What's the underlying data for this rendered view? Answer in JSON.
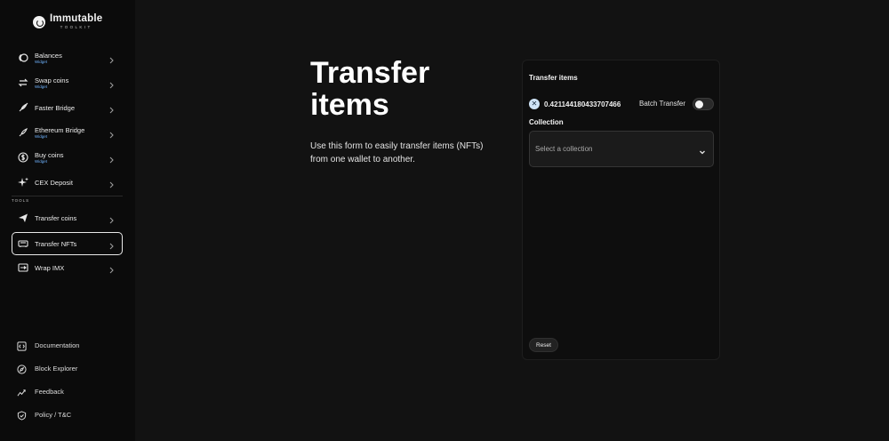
{
  "app": {
    "name": "Immutable",
    "sub": "TOOLKIT"
  },
  "sidebar": {
    "items": [
      {
        "label": "Balances",
        "badge": "Widget",
        "icon": "coins-icon"
      },
      {
        "label": "Swap coins",
        "badge": "Widget",
        "icon": "swap-icon"
      },
      {
        "label": "Faster Bridge",
        "badge": "",
        "icon": "rocket-icon"
      },
      {
        "label": "Ethereum Bridge",
        "badge": "Widget",
        "icon": "rocket-icon"
      },
      {
        "label": "Buy coins",
        "badge": "Widget",
        "icon": "dollar-icon"
      },
      {
        "label": "CEX Deposit",
        "badge": "",
        "icon": "sparkle-icon"
      }
    ],
    "tools_label": "TOOLS",
    "tools": [
      {
        "label": "Transfer coins",
        "icon": "send-icon"
      },
      {
        "label": "Transfer NFTs",
        "icon": "card-icon",
        "active": true
      },
      {
        "label": "Wrap IMX",
        "icon": "wrap-icon"
      }
    ],
    "footer": [
      {
        "label": "Documentation",
        "icon": "code-icon"
      },
      {
        "label": "Block Explorer",
        "icon": "compass-icon"
      },
      {
        "label": "Feedback",
        "icon": "feedback-icon"
      },
      {
        "label": "Policy / T&C",
        "icon": "shield-icon"
      }
    ]
  },
  "main": {
    "title": "Transfer items",
    "description": "Use this form to easily transfer items (NFTs) from one wallet to another."
  },
  "card": {
    "title": "Transfer items",
    "balance": "0.421144180433707466",
    "batch_label": "Batch Transfer",
    "batch_enabled": false,
    "collection_label": "Collection",
    "collection_placeholder": "Select a collection",
    "reset_label": "Reset"
  },
  "colors": {
    "background": "#121212",
    "sidebar": "#0b0b0b",
    "badge": "#6fb3ff"
  }
}
